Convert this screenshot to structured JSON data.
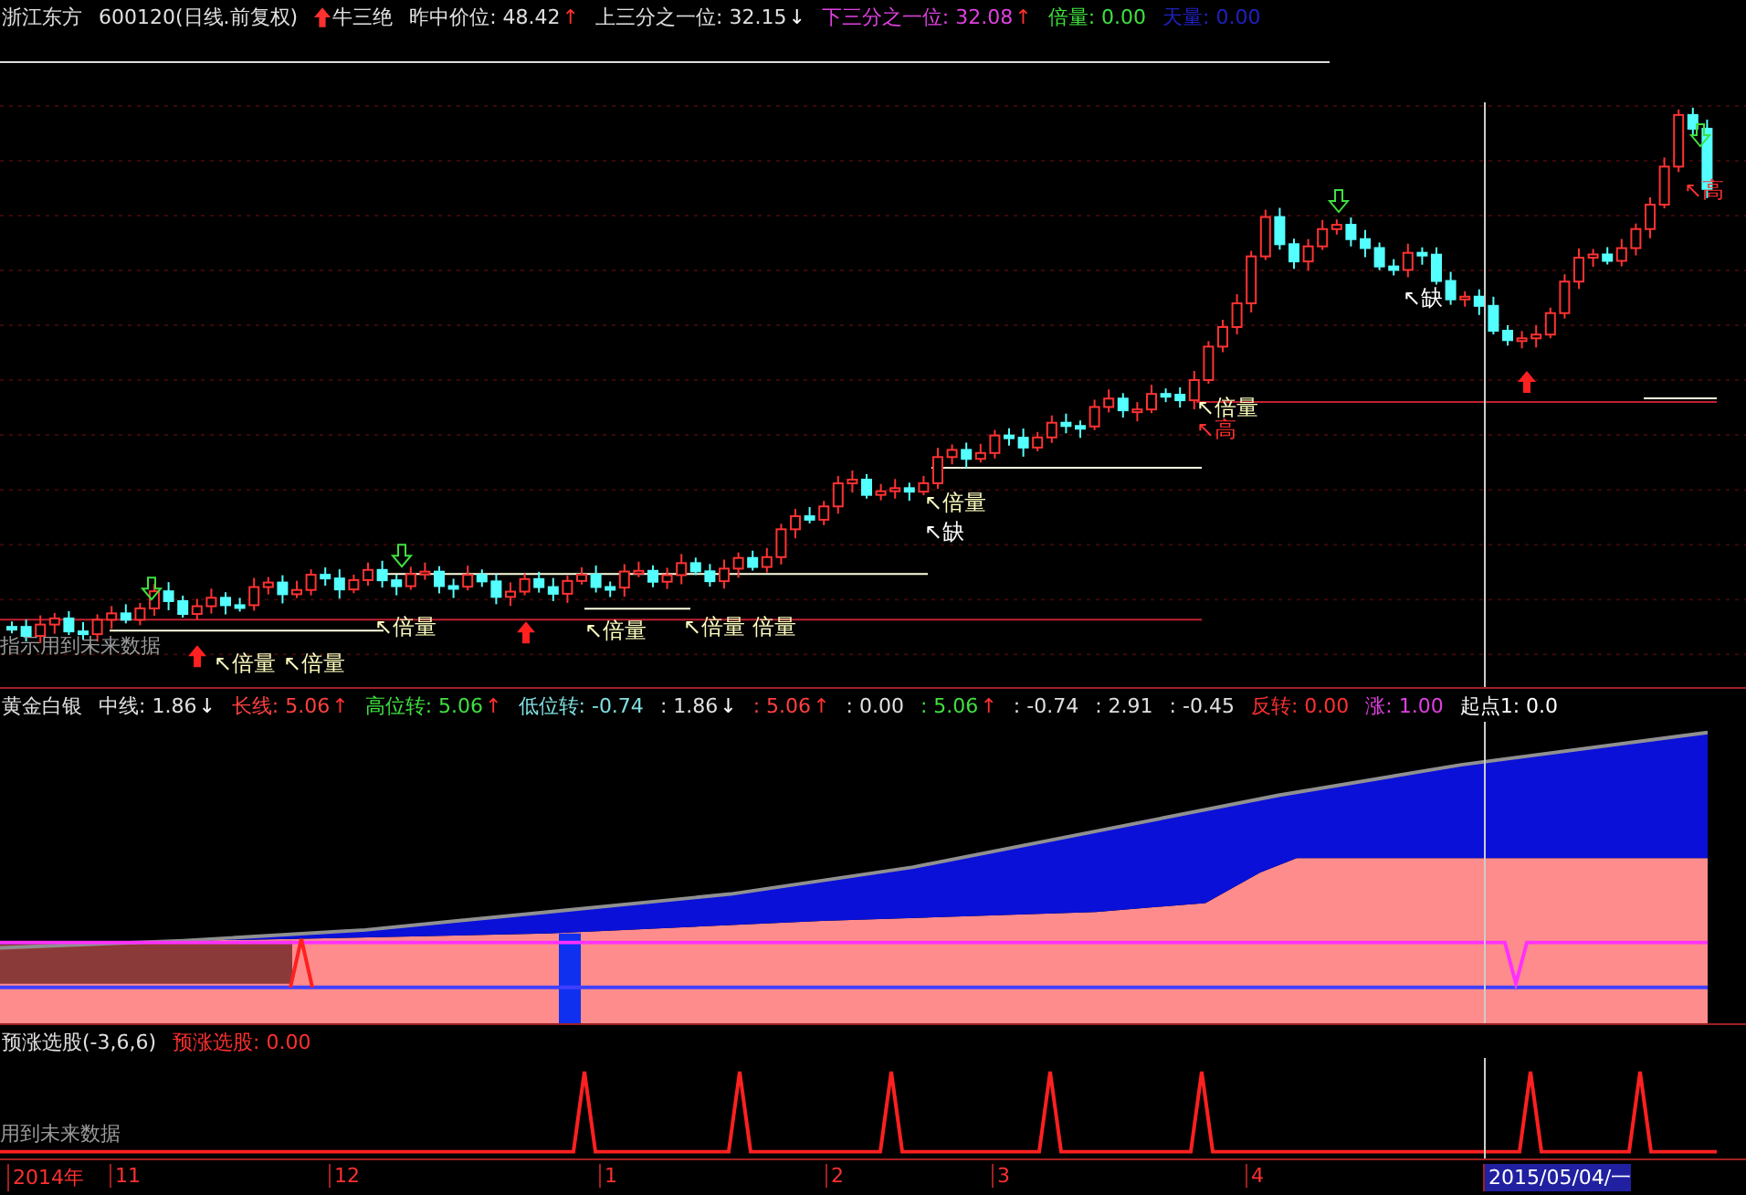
{
  "main_panel": {
    "header": [
      {
        "text": "浙江东方",
        "color": "#e0e0e0"
      },
      {
        "text": "600120(日线.前复权)",
        "color": "#e0e0e0"
      },
      {
        "text": "牛三绝",
        "color": "#e0e0e0",
        "kind": "signal"
      },
      {
        "text": "昨中价位: 48.42",
        "color": "#e0e0e0",
        "arrow": "↑",
        "rising": true
      },
      {
        "text": "上三分之一位: 32.15",
        "color": "#e0e0e0",
        "arrow": "↓",
        "rising": false
      },
      {
        "text": "下三分之一位: 32.08",
        "color": "#e040e0",
        "arrow": "↑",
        "rising": true
      },
      {
        "text": "倍量: 0.00",
        "color": "#40e040"
      },
      {
        "text": "天量: 0.00",
        "color": "#2020c0"
      }
    ],
    "annotations": [
      {
        "text": "↖倍量",
        "color": "#ffffc0"
      },
      {
        "text": "↖倍量",
        "color": "#ffffc0"
      },
      {
        "text": "↖倍量",
        "color": "#ffffc0"
      },
      {
        "text": "↖倍量",
        "color": "#ffffc0"
      },
      {
        "text": "↖倍量",
        "color": "#ffffc0"
      },
      {
        "text": "倍量",
        "color": "#ffffc0"
      },
      {
        "text": "↖倍量",
        "color": "#ffffc0"
      },
      {
        "text": "↖倍量",
        "color": "#ffffc0"
      },
      {
        "text": "↖缺",
        "color": "#ffffff"
      },
      {
        "text": "↖缺",
        "color": "#ffffff"
      },
      {
        "text": "↖高",
        "color": "#ff3030"
      },
      {
        "text": "↖高",
        "color": "#ff3030"
      }
    ],
    "note": "指示用到未来数据"
  },
  "indicator_panel": {
    "header": [
      {
        "text": "黄金白银",
        "color": "#e0e0e0"
      },
      {
        "text": "中线: 1.86",
        "color": "#e0e0e0",
        "arrow": "↓",
        "rising": false
      },
      {
        "text": "长线: 5.06",
        "color": "#ff4040",
        "arrow": "↑",
        "rising": true
      },
      {
        "text": "高位转: 5.06",
        "color": "#40e040",
        "arrow": "↑",
        "rising": true
      },
      {
        "text": "低位转: -0.74",
        "color": "#80e0e0"
      },
      {
        "text": ": 1.86",
        "color": "#e0e0e0",
        "arrow": "↓",
        "rising": false
      },
      {
        "text": ": 5.06",
        "color": "#ff4040",
        "arrow": "↑",
        "rising": true
      },
      {
        "text": ": 0.00",
        "color": "#e0e0e0"
      },
      {
        "text": ": 5.06",
        "color": "#40e040",
        "arrow": "↑",
        "rising": true
      },
      {
        "text": ": -0.74",
        "color": "#e0e0e0"
      },
      {
        "text": ": 2.91",
        "color": "#e0e0e0"
      },
      {
        "text": ": -0.45",
        "color": "#e0e0e0"
      },
      {
        "text": "反转: 0.00",
        "color": "#ff3030"
      },
      {
        "text": "涨: 1.00",
        "color": "#e040e0"
      },
      {
        "text": "起点1: 0.0",
        "color": "#ffffff"
      }
    ]
  },
  "signal_panel": {
    "header": [
      {
        "text": "预涨选股(-3,6,6)",
        "color": "#e0e0e0"
      },
      {
        "text": "预涨选股: 0.00",
        "color": "#ff3030"
      }
    ],
    "note": "用到未来数据"
  },
  "time_axis": [
    {
      "text": "2014年",
      "selected": false
    },
    {
      "text": "11",
      "selected": false
    },
    {
      "text": "12",
      "selected": false
    },
    {
      "text": "1",
      "selected": false
    },
    {
      "text": "2",
      "selected": false
    },
    {
      "text": "3",
      "selected": false
    },
    {
      "text": "4",
      "selected": false
    },
    {
      "text": "2015/05/04/一",
      "selected": true
    }
  ]
}
